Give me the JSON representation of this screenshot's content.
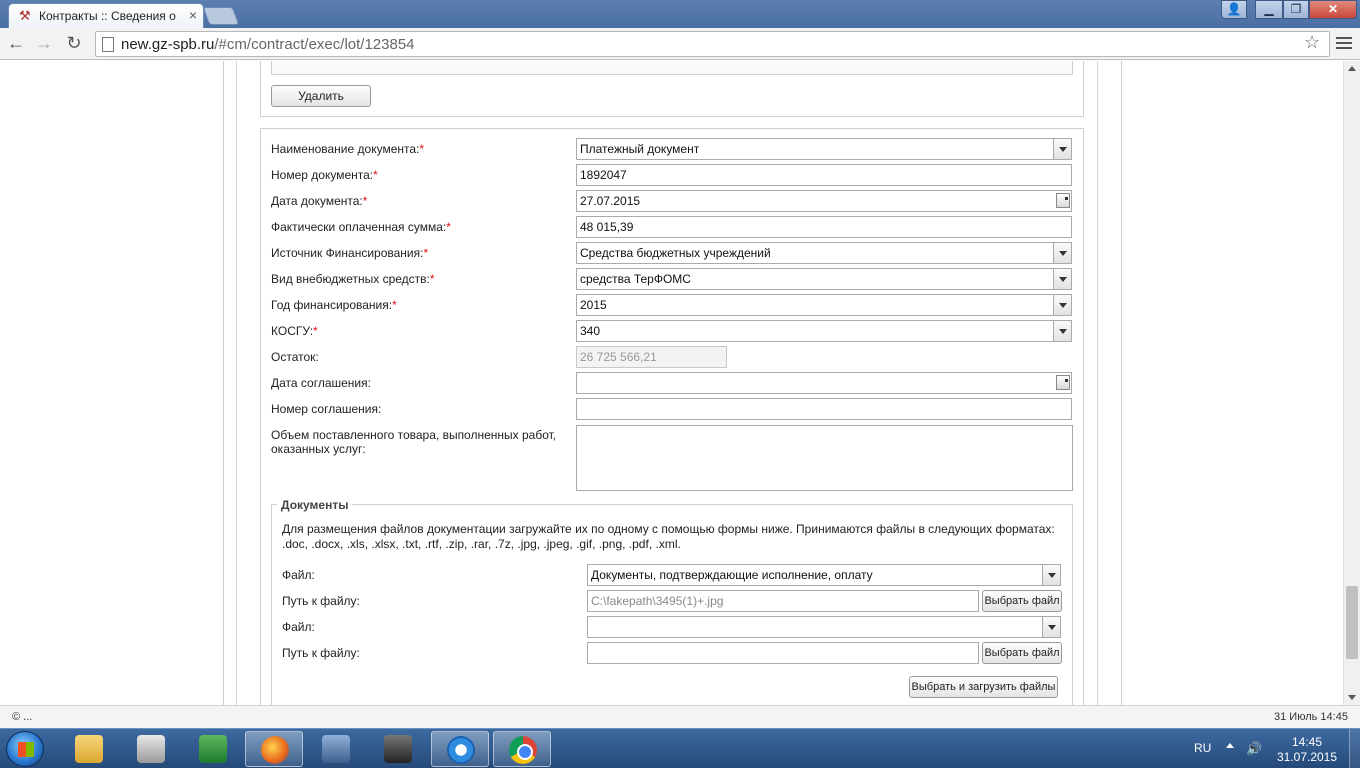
{
  "browser": {
    "tab_title": "Контракты :: Сведения о",
    "url_domain": "new.gz-spb.ru",
    "url_path": "/#cm/contract/exec/lot/123854"
  },
  "top": {
    "delete_label": "Удалить"
  },
  "form": {
    "doc_name": {
      "label": "Наименование документа:",
      "value": "Платежный документ"
    },
    "doc_number": {
      "label": "Номер документа:",
      "value": "1892047"
    },
    "doc_date": {
      "label": "Дата документа:",
      "value": "27.07.2015"
    },
    "paid_sum": {
      "label": "Фактически оплаченная сумма:",
      "value": "48 015,39"
    },
    "funding_source": {
      "label": "Источник Финансирования:",
      "value": "Средства бюджетных учреждений"
    },
    "extra_budget": {
      "label": "Вид внебюджетных средств:",
      "value": "средства ТерФОМС"
    },
    "funding_year": {
      "label": "Год финансирования:",
      "value": "2015"
    },
    "kosgu": {
      "label": "КОСГУ:",
      "value": "340"
    },
    "remainder": {
      "label": "Остаток:",
      "value": "26 725 566,21"
    },
    "agreement_date": {
      "label": "Дата соглашения:",
      "value": ""
    },
    "agreement_number": {
      "label": "Номер соглашения:",
      "value": ""
    },
    "volume": {
      "label": "Объем поставленного товара, выполненных работ, оказанных услуг:",
      "value": ""
    },
    "required_mark": "*"
  },
  "documents": {
    "legend": "Документы",
    "note": "Для размещения файлов документации загружайте их по одному с помощью формы ниже. Принимаются файлы в следующих форматах: .doc, .docx, .xls, .xlsx, .txt, .rtf, .zip, .rar, .7z, .jpg, .jpeg, .gif, .png, .pdf, .xml.",
    "rows": [
      {
        "file_label": "Файл:",
        "file_value": "Документы, подтверждающие исполнение, оплату",
        "path_label": "Путь к файлу:",
        "path_value": "C:\\fakepath\\3495(1)+.jpg",
        "browse_label": "Выбрать файл"
      },
      {
        "file_label": "Файл:",
        "file_value": "",
        "path_label": "Путь к файлу:",
        "path_value": "",
        "browse_label": "Выбрать файл"
      }
    ],
    "upload_label": "Выбрать и загрузить файлы"
  },
  "statusbar": {
    "left": "© ...",
    "right": "31 Июль 14:45"
  },
  "taskbar": {
    "lang": "RU",
    "time": "14:45",
    "date": "31.07.2015"
  },
  "colors": {
    "required": "#e01010",
    "taskbar": "#2f5a8e"
  }
}
